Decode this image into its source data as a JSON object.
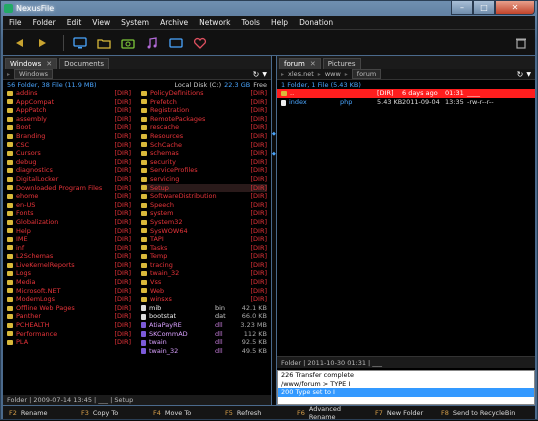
{
  "window": {
    "title": "NexusFile"
  },
  "menu": [
    "File",
    "Folder",
    "Edit",
    "View",
    "System",
    "Archive",
    "Network",
    "Tools",
    "Help",
    "Donation"
  ],
  "toolbar_icons": [
    "back-arrow-icon",
    "forward-arrow-icon",
    "monitor-icon",
    "folder-icon",
    "camera-icon",
    "music-icon",
    "screen-icon",
    "heart-icon",
    "trash-icon"
  ],
  "left": {
    "tabs": [
      {
        "label": "Windows"
      },
      {
        "label": "Documents"
      }
    ],
    "path": [
      "Windows"
    ],
    "info_left": "56 Folder, 38 File (11.9 MB)",
    "info_drive": "Local Disk (C:)",
    "info_free": "22.3 GB",
    "info_free_label": "Free",
    "col1": [
      {
        "name": "addins",
        "type": "[DIR]"
      },
      {
        "name": "AppCompat",
        "type": "[DIR]"
      },
      {
        "name": "AppPatch",
        "type": "[DIR]"
      },
      {
        "name": "assembly",
        "type": "[DIR]"
      },
      {
        "name": "Boot",
        "type": "[DIR]"
      },
      {
        "name": "Branding",
        "type": "[DIR]"
      },
      {
        "name": "CSC",
        "type": "[DIR]"
      },
      {
        "name": "Cursors",
        "type": "[DIR]"
      },
      {
        "name": "debug",
        "type": "[DIR]"
      },
      {
        "name": "diagnostics",
        "type": "[DIR]"
      },
      {
        "name": "DigitalLocker",
        "type": "[DIR]"
      },
      {
        "name": "Downloaded Program Files",
        "type": "[DIR]"
      },
      {
        "name": "ehome",
        "type": "[DIR]"
      },
      {
        "name": "en-US",
        "type": "[DIR]"
      },
      {
        "name": "Fonts",
        "type": "[DIR]"
      },
      {
        "name": "Globalization",
        "type": "[DIR]"
      },
      {
        "name": "Help",
        "type": "[DIR]"
      },
      {
        "name": "IME",
        "type": "[DIR]"
      },
      {
        "name": "inf",
        "type": "[DIR]"
      },
      {
        "name": "L2Schemas",
        "type": "[DIR]"
      },
      {
        "name": "LiveKernelReports",
        "type": "[DIR]"
      },
      {
        "name": "Logs",
        "type": "[DIR]"
      },
      {
        "name": "Media",
        "type": "[DIR]"
      },
      {
        "name": "Microsoft.NET",
        "type": "[DIR]"
      },
      {
        "name": "ModemLogs",
        "type": "[DIR]"
      },
      {
        "name": "Offline Web Pages",
        "type": "[DIR]"
      },
      {
        "name": "Panther",
        "type": "[DIR]"
      },
      {
        "name": "PCHEALTH",
        "type": "[DIR]"
      },
      {
        "name": "Performance",
        "type": "[DIR]"
      },
      {
        "name": "PLA",
        "type": "[DIR]"
      }
    ],
    "col2": [
      {
        "name": "PolicyDefinitions",
        "ext": "",
        "size": "[DIR]"
      },
      {
        "name": "Prefetch",
        "ext": "",
        "size": "[DIR]"
      },
      {
        "name": "Registration",
        "ext": "",
        "size": "[DIR]"
      },
      {
        "name": "RemotePackages",
        "ext": "",
        "size": "[DIR]"
      },
      {
        "name": "rescache",
        "ext": "",
        "size": "[DIR]"
      },
      {
        "name": "Resources",
        "ext": "",
        "size": "[DIR]"
      },
      {
        "name": "SchCache",
        "ext": "",
        "size": "[DIR]"
      },
      {
        "name": "schemas",
        "ext": "",
        "size": "[DIR]"
      },
      {
        "name": "security",
        "ext": "",
        "size": "[DIR]"
      },
      {
        "name": "ServiceProfiles",
        "ext": "",
        "size": "[DIR]"
      },
      {
        "name": "servicing",
        "ext": "",
        "size": "[DIR]"
      },
      {
        "name": "Setup",
        "ext": "",
        "size": "[DIR]"
      },
      {
        "name": "SoftwareDistribution",
        "ext": "",
        "size": "[DIR]"
      },
      {
        "name": "Speech",
        "ext": "",
        "size": "[DIR]"
      },
      {
        "name": "system",
        "ext": "",
        "size": "[DIR]"
      },
      {
        "name": "System32",
        "ext": "",
        "size": "[DIR]"
      },
      {
        "name": "SysWOW64",
        "ext": "",
        "size": "[DIR]"
      },
      {
        "name": "TAPI",
        "ext": "",
        "size": "[DIR]"
      },
      {
        "name": "Tasks",
        "ext": "",
        "size": "[DIR]"
      },
      {
        "name": "Temp",
        "ext": "",
        "size": "[DIR]"
      },
      {
        "name": "tracing",
        "ext": "",
        "size": "[DIR]"
      },
      {
        "name": "twain_32",
        "ext": "",
        "size": "[DIR]"
      },
      {
        "name": "Vss",
        "ext": "",
        "size": "[DIR]"
      },
      {
        "name": "Web",
        "ext": "",
        "size": "[DIR]"
      },
      {
        "name": "winsxs",
        "ext": "",
        "size": "[DIR]"
      },
      {
        "name": "mib",
        "ext": "bin",
        "size": "42.1 KB"
      },
      {
        "name": "bootstat",
        "ext": "dat",
        "size": "66.0 KB"
      },
      {
        "name": "AtiaPayRE",
        "ext": "dll",
        "size": "3.23 MB"
      },
      {
        "name": "SKCommAD",
        "ext": "dll",
        "size": "112 KB"
      },
      {
        "name": "twain",
        "ext": "dll",
        "size": "92.5 KB"
      },
      {
        "name": "twain_32",
        "ext": "dll",
        "size": "49.5 KB"
      }
    ],
    "status": "Folder  |  2009-07-14 13:45  |  ___  |  Setup"
  },
  "right": {
    "tabs": [
      {
        "label": "forum"
      },
      {
        "label": "Pictures"
      }
    ],
    "path": [
      "xles.net",
      "www",
      "forum"
    ],
    "info": "1 Folder, 1 File (5.43 KB)",
    "rows": [
      {
        "name": "..",
        "ext": "",
        "type": "[DIR]",
        "date": "6 days ago",
        "time": "01:31",
        "attr": "____"
      },
      {
        "name": "index",
        "ext": "php",
        "type": "5.43 KB",
        "date": "2011-09-04",
        "time": "13:35",
        "attr": "-rw-r--r--"
      }
    ],
    "status": "Folder  |  2011-10-30 01:31  |  ___",
    "log": [
      "226 Transfer complete",
      "/www/forum > TYPE I",
      "200 Type set to I"
    ]
  },
  "fkeys": [
    {
      "key": "F2",
      "label": "Rename"
    },
    {
      "key": "F3",
      "label": "Copy To"
    },
    {
      "key": "F4",
      "label": "Move To"
    },
    {
      "key": "F5",
      "label": "Refresh"
    },
    {
      "key": "F6",
      "label": "Advanced Rename"
    },
    {
      "key": "F7",
      "label": "New Folder"
    },
    {
      "key": "F8",
      "label": "Send to RecycleBin"
    }
  ],
  "colors": {
    "accent_blue": "#4aa6ff",
    "dir_red": "#e8343a",
    "selection_red": "#ff1e1e",
    "log_select": "#3399ff"
  }
}
